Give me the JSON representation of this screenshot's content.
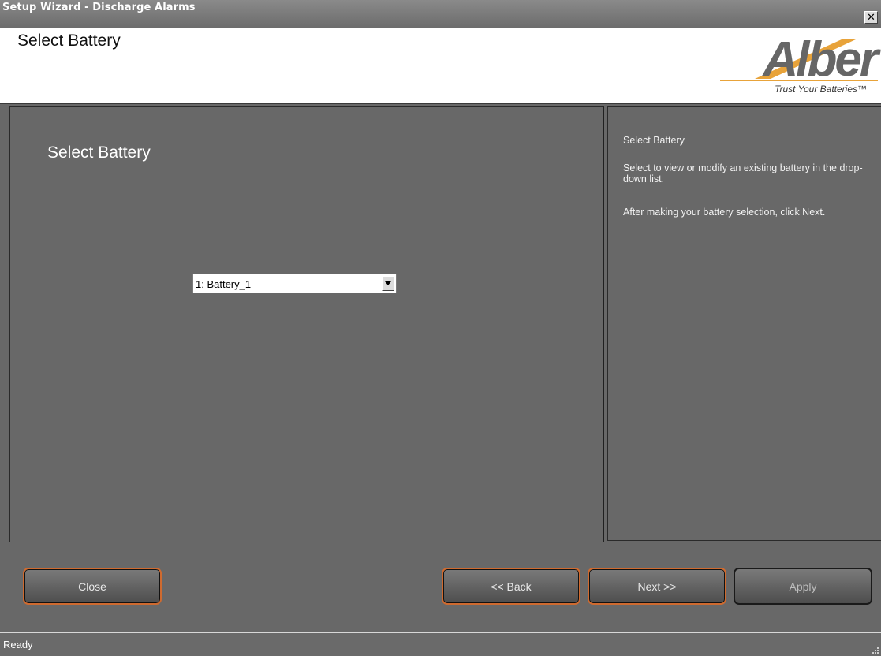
{
  "window": {
    "title": "Setup Wizard - Discharge Alarms",
    "close_glyph": "✕"
  },
  "header": {
    "title": "Select Battery",
    "logo_word": "Alber",
    "logo_tagline": "Trust Your Batteries™",
    "logo_color": "#666666",
    "accent_color": "#e8a33a"
  },
  "main": {
    "title": "Select Battery",
    "battery_select": {
      "selected": "1: Battery_1"
    }
  },
  "help": {
    "heading": "Select Battery",
    "line1": "Select to view or modify an existing battery in the drop-down list.",
    "line2": "After making your battery selection, click Next."
  },
  "buttons": {
    "close": "Close",
    "back": "<< Back",
    "next": "Next >>",
    "apply": "Apply"
  },
  "status": {
    "text": "Ready"
  },
  "colors": {
    "button_border": "#cf6a2f",
    "panel_bg": "#686868"
  }
}
